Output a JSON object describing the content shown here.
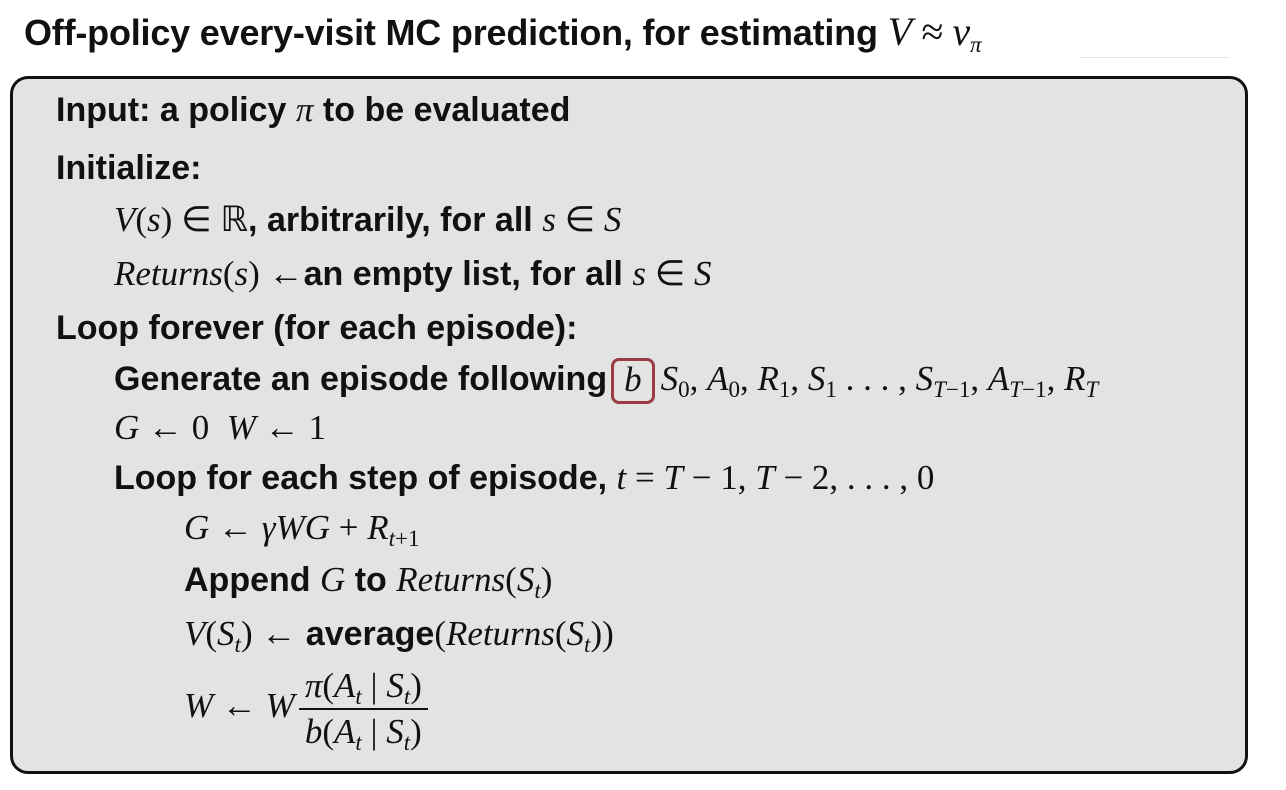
{
  "title": {
    "text": "Off-policy every-visit MC prediction, for estimating",
    "math": "V ≈ v",
    "math_sub": "π"
  },
  "input_line": {
    "before": "Input: a policy",
    "var": "π",
    "after": "to be evaluated"
  },
  "initialize_label": "Initialize:",
  "init_v": {
    "math": "V(s) ∈ ℝ",
    "text": ", arbitrarily, for all",
    "math2": "s ∈ S"
  },
  "init_returns": {
    "math": "Returns(s) ←",
    "text": "an empty list, for all",
    "math2": "s ∈ S"
  },
  "loop_forever": "Loop forever (for each episode):",
  "generate": {
    "text": "Generate an episode following",
    "policy_highlight": "b",
    "sequence": "S0, A0, R1, S1 . . . , ST−1, AT−1, RT"
  },
  "init_gw": "G ← 0  W ← 1",
  "loop_step": {
    "text": "Loop for each step of episode,",
    "math": "t = T − 1, T − 2, . . . , 0"
  },
  "update_g": "G ← γWG + Rt+1",
  "append": {
    "word1": "Append",
    "var": "G",
    "word2": "to",
    "math": "Returns(St)"
  },
  "update_v": {
    "math": "V(St) ←",
    "fn": "average",
    "arg": "(Returns(St))"
  },
  "update_w": {
    "lhs": "W ← W",
    "numerator": "π(At | St)",
    "denominator": "b(At | St)"
  },
  "colors": {
    "box_fill": "#e3e3e3",
    "box_border": "#111111",
    "highlight_border": "#9a3b45"
  }
}
